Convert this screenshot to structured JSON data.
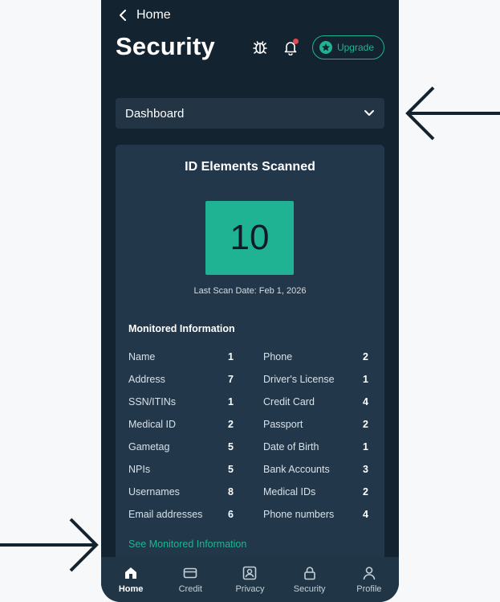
{
  "nav": {
    "back_label": "Home"
  },
  "page": {
    "title": "Security"
  },
  "header": {
    "upgrade_label": "Upgrade"
  },
  "dropdown": {
    "selected": "Dashboard"
  },
  "scan": {
    "title": "ID Elements Scanned",
    "count": "10",
    "last_scan": "Last Scan Date: Feb 1, 2026"
  },
  "monitored": {
    "title": "Monitored Information",
    "rows": [
      {
        "l_label": "Name",
        "l_val": "1",
        "r_label": "Phone",
        "r_val": "2"
      },
      {
        "l_label": "Address",
        "l_val": "7",
        "r_label": "Driver's License",
        "r_val": "1"
      },
      {
        "l_label": "SSN/ITINs",
        "l_val": "1",
        "r_label": "Credit Card",
        "r_val": "4"
      },
      {
        "l_label": "Medical ID",
        "l_val": "2",
        "r_label": "Passport",
        "r_val": "2"
      },
      {
        "l_label": "Gametag",
        "l_val": "5",
        "r_label": "Date of Birth",
        "r_val": "1"
      },
      {
        "l_label": "NPIs",
        "l_val": "5",
        "r_label": "Bank Accounts",
        "r_val": "3"
      },
      {
        "l_label": "Usernames",
        "l_val": "8",
        "r_label": "Medical IDs",
        "r_val": "2"
      },
      {
        "l_label": "Email addresses",
        "l_val": "6",
        "r_label": "Phone numbers",
        "r_val": "4"
      }
    ],
    "link": "See Monitored Information"
  },
  "tabs": [
    {
      "label": "Home",
      "icon": "home-icon"
    },
    {
      "label": "Credit",
      "icon": "credit-card-icon"
    },
    {
      "label": "Privacy",
      "icon": "privacy-icon"
    },
    {
      "label": "Security",
      "icon": "lock-icon"
    },
    {
      "label": "Profile",
      "icon": "user-icon"
    }
  ],
  "colors": {
    "accent": "#1fb393",
    "background": "#13232f",
    "card": "#22384a",
    "notification": "#e5484d"
  }
}
